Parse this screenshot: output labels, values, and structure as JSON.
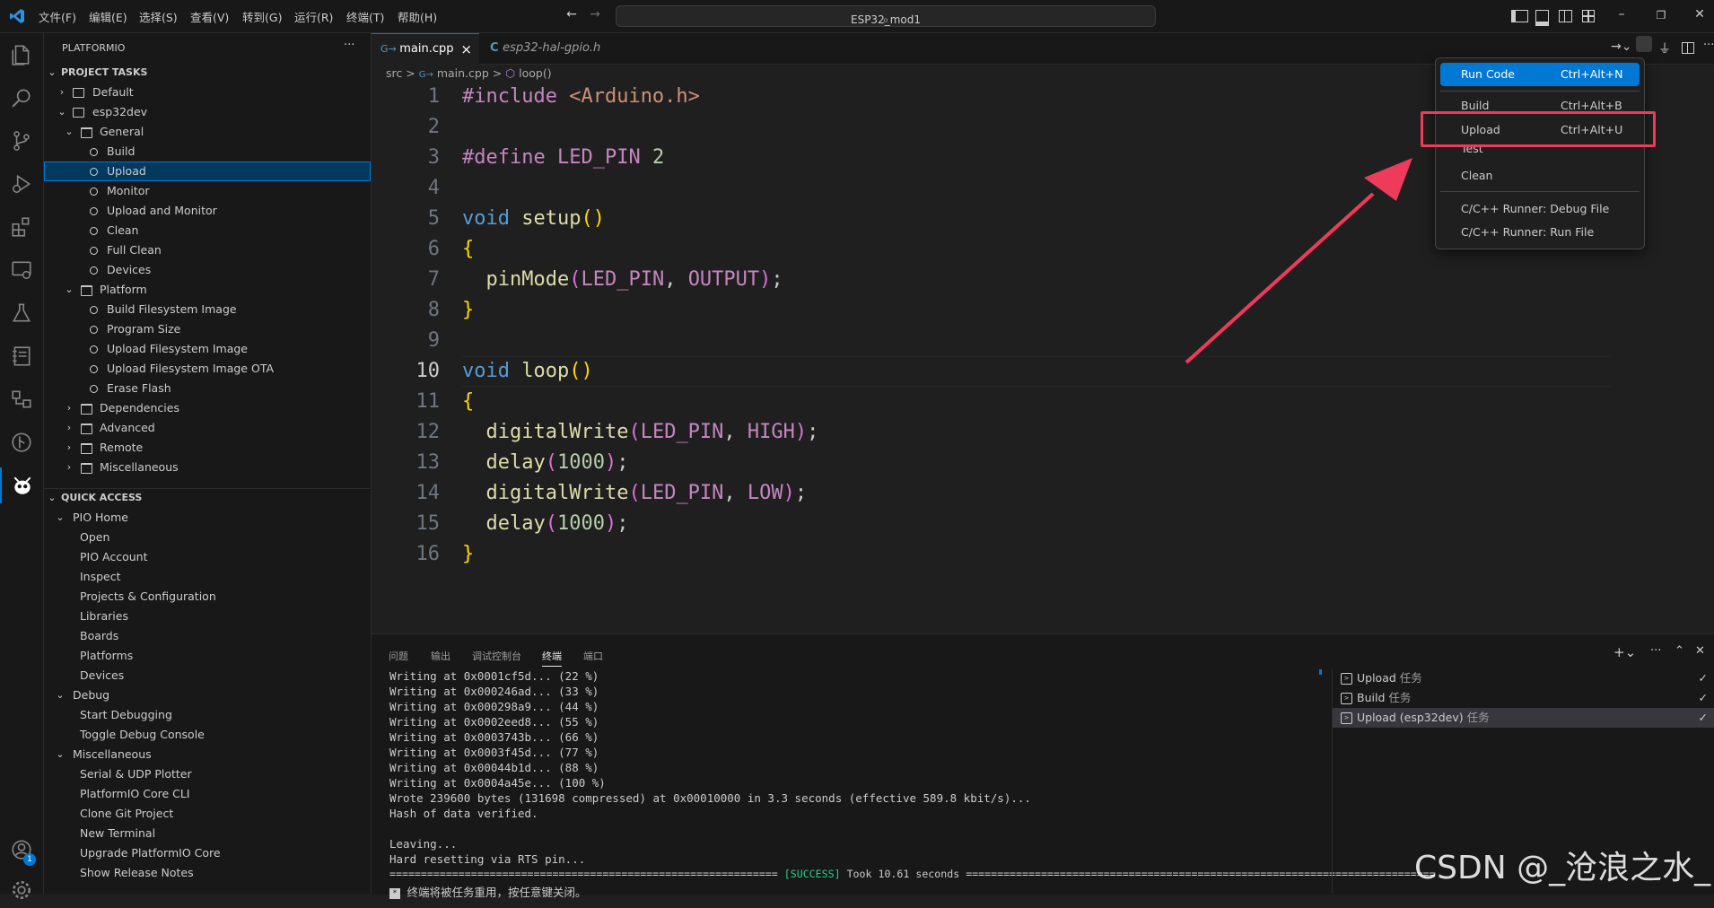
{
  "menubar": {
    "items": [
      "文件(F)",
      "编辑(E)",
      "选择(S)",
      "查看(V)",
      "转到(G)",
      "运行(R)",
      "终端(T)",
      "帮助(H)"
    ],
    "search_value": "ESP32_mod1"
  },
  "activity_bar": {
    "icons": [
      "files-icon",
      "search-icon",
      "source-control-icon",
      "run-debug-icon",
      "extensions-icon",
      "remote-explorer-icon",
      "testing-icon",
      "notebook-icon",
      "outline-icon",
      "git-graph-icon",
      "platformio-icon",
      "accounts-icon",
      "settings-icon"
    ],
    "accounts_badge": "1"
  },
  "sidebar": {
    "title": "PLATFORMIO",
    "more": "···",
    "project_tasks": {
      "header": "PROJECT TASKS",
      "items": [
        "Default",
        "esp32dev",
        "General",
        "Build",
        "Upload",
        "Monitor",
        "Upload and Monitor",
        "Clean",
        "Full Clean",
        "Devices",
        "Platform",
        "Build Filesystem Image",
        "Program Size",
        "Upload Filesystem Image",
        "Upload Filesystem Image OTA",
        "Erase Flash",
        "Dependencies",
        "Advanced",
        "Remote",
        "Miscellaneous"
      ],
      "selected": "Upload"
    },
    "quick_access": {
      "header": "QUICK ACCESS",
      "items": [
        "PIO Home",
        "Open",
        "PIO Account",
        "Inspect",
        "Projects & Configuration",
        "Libraries",
        "Boards",
        "Platforms",
        "Devices",
        "Debug",
        "Start Debugging",
        "Toggle Debug Console",
        "Miscellaneous",
        "Serial & UDP Plotter",
        "PlatformIO Core CLI",
        "Clone Git Project",
        "New Terminal",
        "Upgrade PlatformIO Core",
        "Show Release Notes"
      ]
    }
  },
  "editor": {
    "tabs": [
      {
        "label": "main.cpp",
        "active": true,
        "close": "×"
      },
      {
        "label": "esp32-hal-gpio.h",
        "active": false
      }
    ],
    "breadcrumb": [
      "src",
      ">",
      "main.cpp",
      ">",
      "loop()"
    ],
    "line_numbers": [
      "1",
      "2",
      "3",
      "4",
      "5",
      "6",
      "7",
      "8",
      "9",
      "10",
      "11",
      "12",
      "13",
      "14",
      "15",
      "16"
    ],
    "current_line": "10",
    "code": {
      "l1_directive": "#include",
      "l1_header": "<Arduino.h>",
      "l3_directive": "#define",
      "l3_macro": "LED_PIN",
      "l3_value": "2",
      "kw_void": "void",
      "fn_setup": "setup",
      "fn_loop": "loop",
      "paren_open": "(",
      "paren_close": ")",
      "brace_open": "{",
      "brace_close": "}",
      "fn_pinmode": "pinMode",
      "fn_digitalwrite": "digitalWrite",
      "fn_delay": "delay",
      "arg_led": "LED_PIN",
      "arg_output": "OUTPUT",
      "arg_high": "HIGH",
      "arg_low": "LOW",
      "arg_ms": "1000",
      "comma": ", ",
      "semicolon": ";"
    }
  },
  "context_menu": {
    "items": [
      {
        "label": "Run Code",
        "shortcut": "Ctrl+Alt+N"
      },
      {
        "label": "Build",
        "shortcut": "Ctrl+Alt+B"
      },
      {
        "label": "Upload",
        "shortcut": "Ctrl+Alt+U"
      },
      {
        "label": "Test",
        "shortcut": ""
      },
      {
        "label": "Clean",
        "shortcut": ""
      },
      {
        "label": "C/C++ Runner: Debug File",
        "shortcut": ""
      },
      {
        "label": "C/C++ Runner: Run File",
        "shortcut": ""
      }
    ],
    "highlighted": "Run Code",
    "annotated": "Upload"
  },
  "panel": {
    "tabs": [
      "问题",
      "输出",
      "调试控制台",
      "终端",
      "端口"
    ],
    "active_tab": "终端",
    "terminal_lines": [
      "Writing at 0x0001cf5d... (22 %)",
      "Writing at 0x000246ad... (33 %)",
      "Writing at 0x000298a9... (44 %)",
      "Writing at 0x0002eed8... (55 %)",
      "Writing at 0x0003743b... (66 %)",
      "Writing at 0x0003f45d... (77 %)",
      "Writing at 0x00044b1d... (88 %)",
      "Writing at 0x0004a45e... (100 %)",
      "Wrote 239600 bytes (131698 compressed) at 0x00010000 in 3.3 seconds (effective 589.8 kbit/s)...",
      "Hash of data verified.",
      "",
      "Leaving...",
      "Hard resetting via RTS pin..."
    ],
    "result_left": "==============================================================",
    "result_success": "[SUCCESS]",
    "result_took": "Took 10.61 seconds",
    "result_right": "===========================================================================",
    "reuse_notice": "终端将被任务重用，按任意键关闭。",
    "tasks": [
      {
        "label": "Upload",
        "suffix": "任务"
      },
      {
        "label": "Build",
        "suffix": "任务"
      },
      {
        "label": "Upload (esp32dev)",
        "suffix": "任务"
      }
    ],
    "check": "✓"
  },
  "watermark": "CSDN @_沧浪之水_",
  "colors": {
    "accent": "#0078d4",
    "annotation": "#ef3b5a",
    "success": "#23d18b"
  }
}
